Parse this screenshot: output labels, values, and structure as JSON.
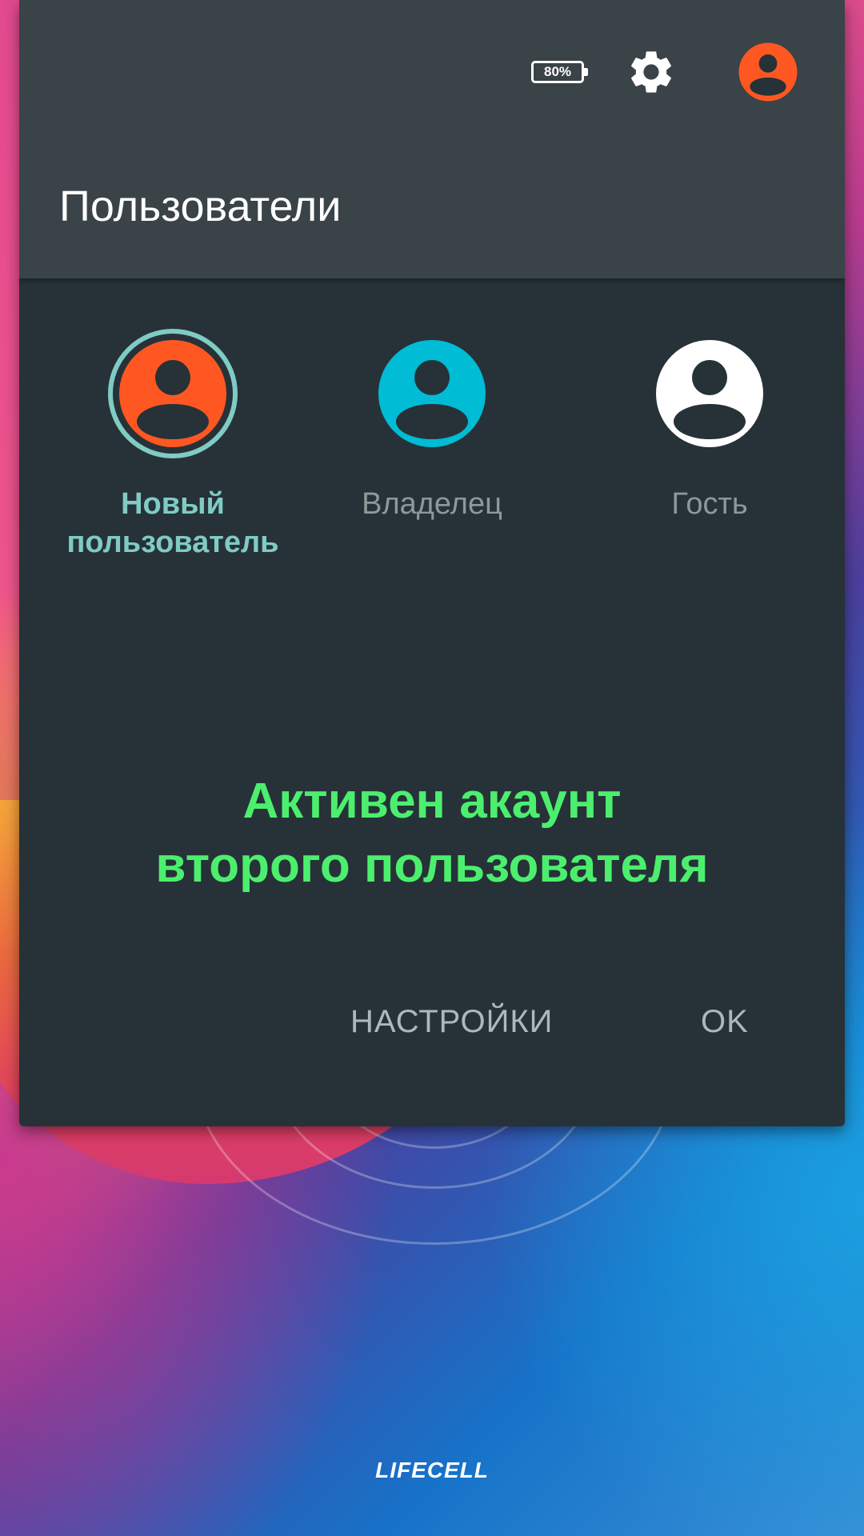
{
  "status_bar": {
    "battery_percent": "80%"
  },
  "panel": {
    "title": "Пользователи"
  },
  "users": [
    {
      "label": "Новый пользователь",
      "color": "#ff5722",
      "active": true
    },
    {
      "label": "Владелец",
      "color": "#00bcd4",
      "active": false
    },
    {
      "label": "Гость",
      "color": "#ffffff",
      "active": false
    }
  ],
  "annotation": {
    "line1": "Активен акаунт",
    "line2": "второго пользователя"
  },
  "actions": {
    "settings_label": "НАСТРОЙКИ",
    "ok_label": "OK"
  },
  "home": {
    "carrier_label": "LIFECELL"
  },
  "colors": {
    "panel_bg": "#263238",
    "header_bg": "#3a4347",
    "active_ring": "#80cbc4",
    "annotation_text": "#4cef6d"
  }
}
